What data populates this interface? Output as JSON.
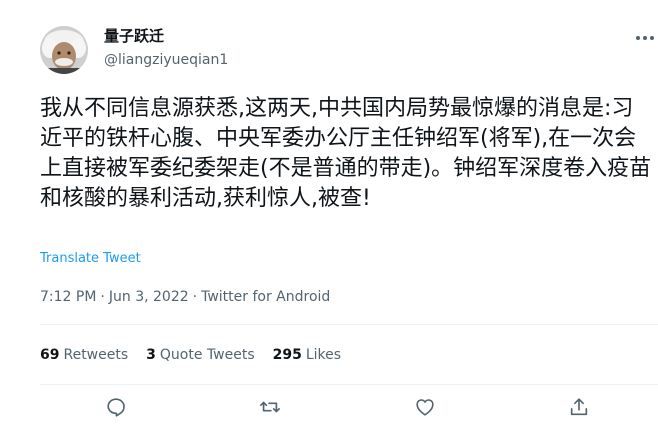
{
  "author": {
    "display_name": "量子跃迁",
    "handle": "@liangziyueqian1"
  },
  "tweet": {
    "text": "我从不同信息源获悉,这两天,中共国内局势最惊爆的消息是:习近平的铁杆心腹、中央军委办公厅主任钟绍军(将军),在一次会上直接被军委纪委架走(不是普通的带走)。钟绍军深度卷入疫苗和核酸的暴利活动,获利惊人,被查!",
    "translate_label": "Translate Tweet"
  },
  "meta": {
    "time": "7:12 PM",
    "date": "Jun 3, 2022",
    "source": "Twitter for Android"
  },
  "stats": {
    "retweets_count": "69",
    "retweets_label": "Retweets",
    "quotes_count": "3",
    "quotes_label": "Quote Tweets",
    "likes_count": "295",
    "likes_label": "Likes"
  },
  "icons": {
    "more": "more-icon",
    "reply": "reply-icon",
    "retweet": "retweet-icon",
    "like": "heart-icon",
    "share": "share-icon"
  },
  "colors": {
    "link": "#1d9bf0",
    "muted": "#536471",
    "text": "#0f1419",
    "divider": "#eff3f4"
  }
}
